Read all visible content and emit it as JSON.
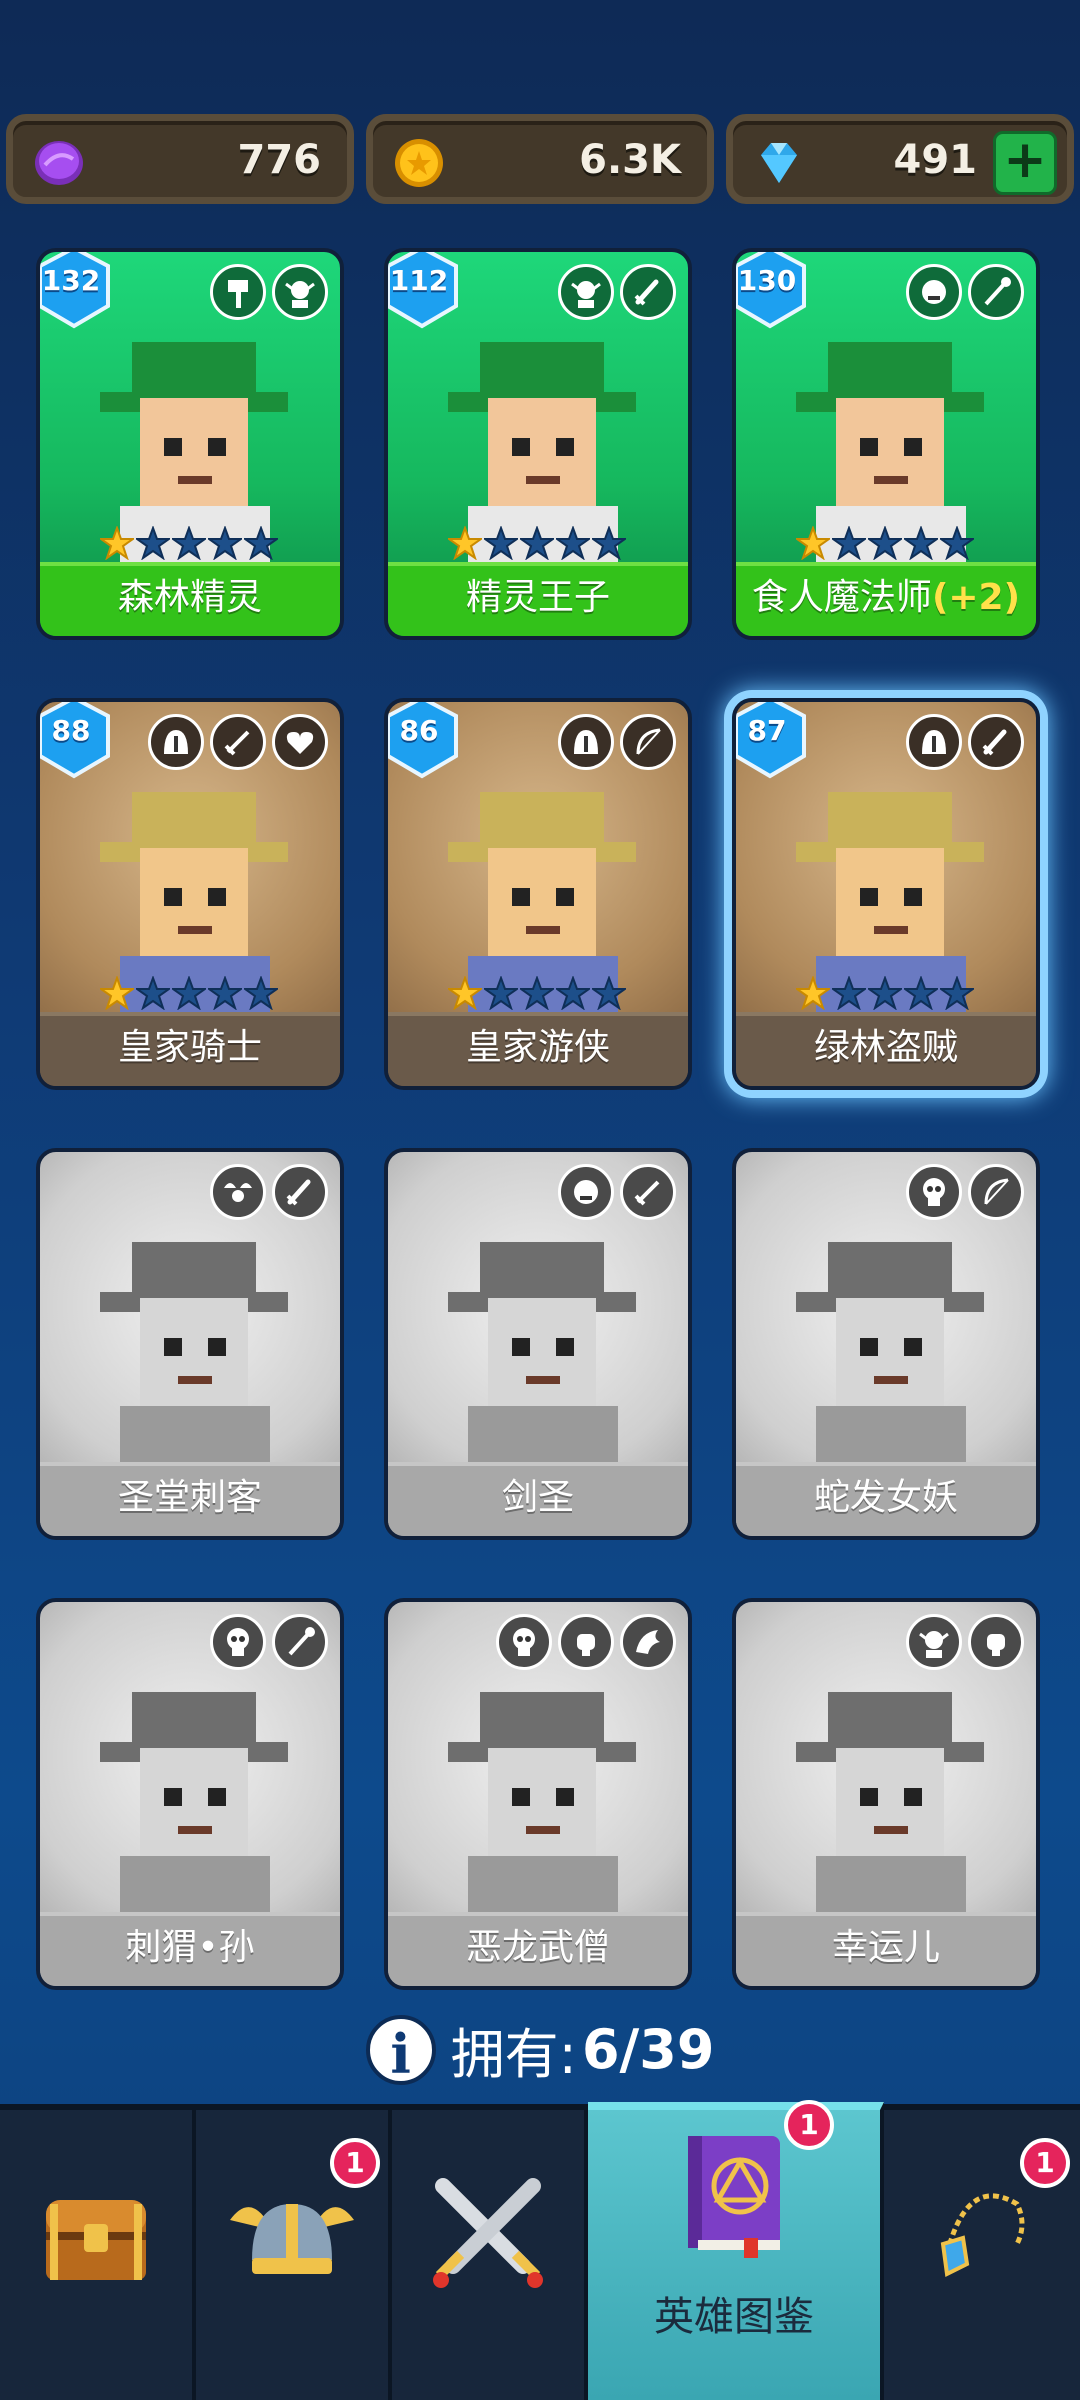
{
  "currencies": [
    {
      "name": "purple-token",
      "value": "776",
      "color": "#9a3fd6"
    },
    {
      "name": "gold-coin",
      "value": "6.3K",
      "color": "#f2b600"
    },
    {
      "name": "diamond",
      "value": "491",
      "color": "#47c4ff"
    }
  ],
  "heroes": [
    {
      "name": "森林精灵",
      "level": "132",
      "stars": 1,
      "state": "owned-green"
    },
    {
      "name": "精灵王子",
      "level": "112",
      "stars": 1,
      "state": "owned-green"
    },
    {
      "name": "食人魔法师",
      "bonus": "(+2)",
      "level": "130",
      "stars": 1,
      "state": "owned-green"
    },
    {
      "name": "皇家骑士",
      "level": "88",
      "stars": 1,
      "state": "owned-brown"
    },
    {
      "name": "皇家游侠",
      "level": "86",
      "stars": 1,
      "state": "owned-brown"
    },
    {
      "name": "绿林盗贼",
      "level": "87",
      "stars": 1,
      "state": "owned-brown",
      "selected": true
    },
    {
      "name": "圣堂刺客",
      "state": "locked"
    },
    {
      "name": "剑圣",
      "state": "locked"
    },
    {
      "name": "蛇发女妖",
      "state": "locked"
    },
    {
      "name": "刺猬•孙",
      "state": "locked"
    },
    {
      "name": "恶龙武僧",
      "state": "locked"
    },
    {
      "name": "幸运儿",
      "state": "locked"
    }
  ],
  "owned": {
    "label": "拥有:",
    "count": "6/39"
  },
  "nav": {
    "tabs": [
      {
        "name": "chest",
        "badge": ""
      },
      {
        "name": "helmet",
        "badge": "1"
      },
      {
        "name": "battle",
        "badge": ""
      },
      {
        "name": "hero-book",
        "label": "英雄图鉴",
        "badge": "1",
        "active": true
      },
      {
        "name": "amulet",
        "badge": "1"
      }
    ]
  }
}
